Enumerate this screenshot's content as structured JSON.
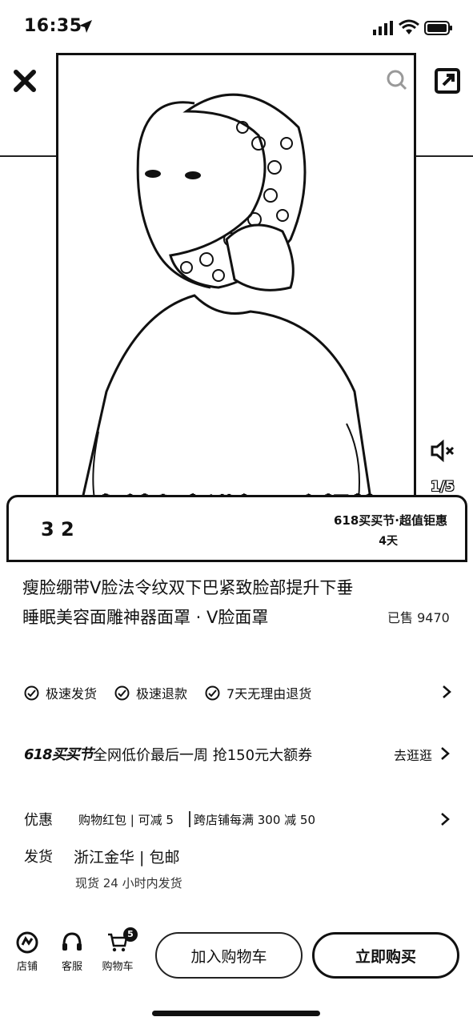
{
  "status_bar": {
    "time": "16:35"
  },
  "media": {
    "caption": "向斜上方进行一个提拉",
    "counter": "1/5"
  },
  "banner": {
    "price": "3 2",
    "promo": "618买买节·超值钜惠",
    "promo_sub": "4天"
  },
  "product": {
    "title": "瘦脸绷带V脸法令纹双下巴紧致脸部提升下垂睡眠美容面雕神器面罩 · V脸面罩",
    "sold": "已售 9470"
  },
  "guarantees": [
    "极速发货",
    "极速退款",
    "7天无理由退货"
  ],
  "promo_row": {
    "logo": "618买买节",
    "text": "全网低价最后一周  抢150元大额券",
    "link": "去逛逛"
  },
  "discount": {
    "label": "优惠",
    "tag1": "购物红包 | 可减 5",
    "tag2": "跨店铺每满 300 减 50"
  },
  "shipping": {
    "label": "发货",
    "location": "浙江金华 | 包邮",
    "sub": "现货    24 小时内发货"
  },
  "bottom_bar": {
    "store": "店铺",
    "service": "客服",
    "cart": "购物车",
    "cart_count": "5",
    "add_to_cart": "加入购物车",
    "buy_now": "立即购买"
  }
}
